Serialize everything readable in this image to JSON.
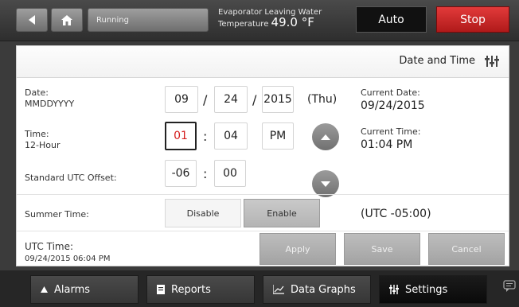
{
  "topbar": {
    "status": "Running",
    "evap_label_1": "Evaporator Leaving Water",
    "evap_label_2": "Temperature",
    "evap_value": "49.0 °F",
    "auto_label": "Auto",
    "stop_label": "Stop"
  },
  "page": {
    "title": "Date and Time"
  },
  "date": {
    "label": "Date:",
    "format": "MMDDYYYY",
    "month": "09",
    "day": "24",
    "year": "2015",
    "weekday": "(Thu)",
    "separator": "/"
  },
  "time": {
    "label": "Time:",
    "format": "12-Hour",
    "hour": "01",
    "minute": "04",
    "ampm": "PM",
    "separator": ":"
  },
  "utc_offset": {
    "label": "Standard UTC Offset:",
    "hours": "-06",
    "minutes": "00",
    "separator": ":"
  },
  "summer_time": {
    "label": "Summer Time:",
    "disable_label": "Disable",
    "enable_label": "Enable",
    "selected": "Enable",
    "utc_display": "(UTC -05:00)"
  },
  "current": {
    "date_label": "Current Date:",
    "date_value": "09/24/2015",
    "time_label": "Current Time:",
    "time_value": "01:04 PM"
  },
  "utc_time": {
    "label": "UTC Time:",
    "value": "09/24/2015 06:04 PM"
  },
  "actions": {
    "apply": "Apply",
    "save": "Save",
    "cancel": "Cancel"
  },
  "nav": {
    "alarms": "Alarms",
    "reports": "Reports",
    "data_graphs": "Data Graphs",
    "settings": "Settings",
    "active": "settings"
  }
}
